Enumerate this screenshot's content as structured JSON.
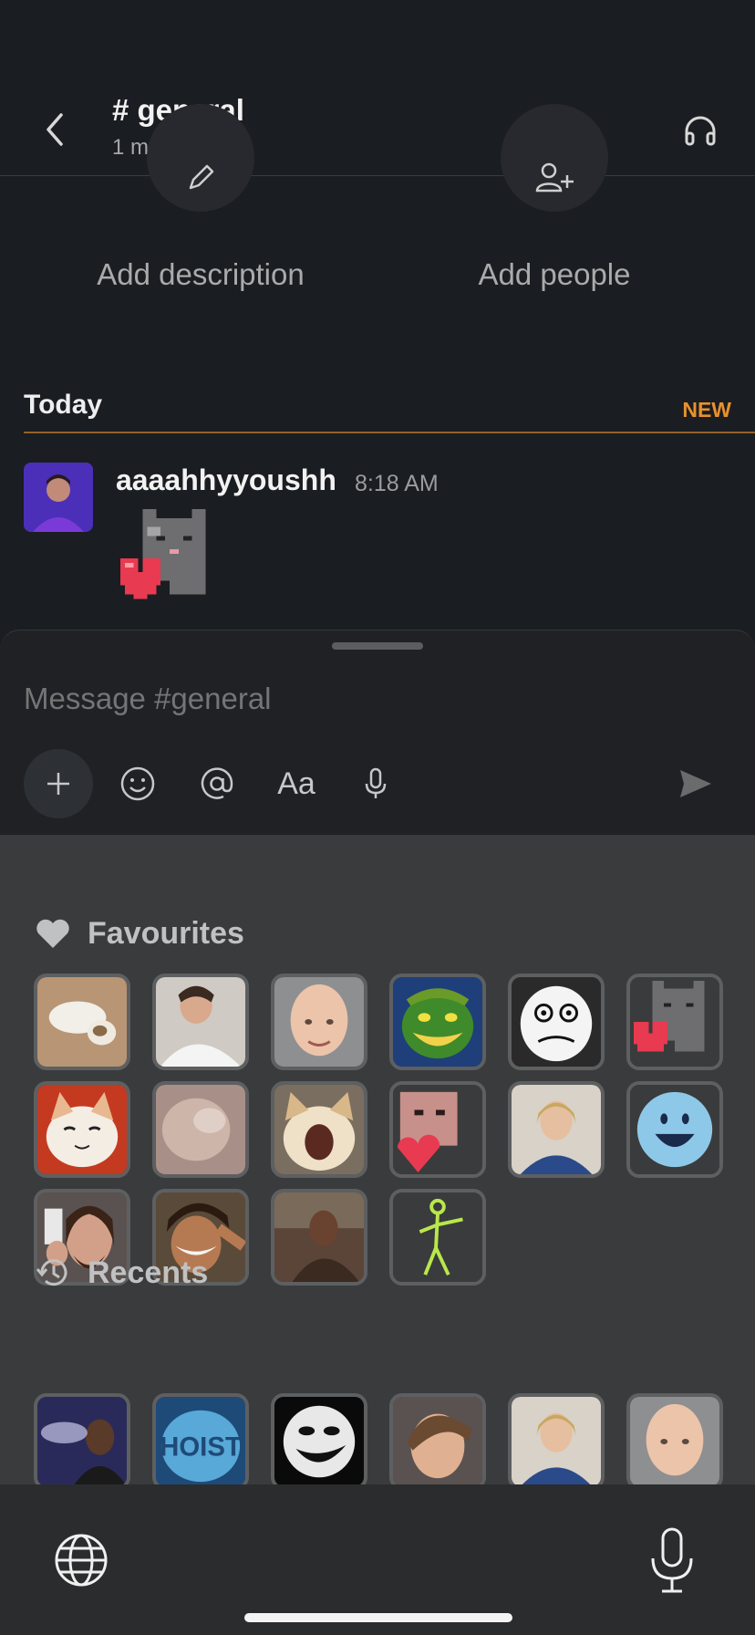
{
  "header": {
    "title": "# general",
    "subtitle": "1 member"
  },
  "intro": {
    "add_description": "Add description",
    "add_people": "Add people"
  },
  "divider": {
    "today": "Today",
    "new_badge": "NEW"
  },
  "message": {
    "user": "aaaahhyyoushh",
    "time": "8:18 AM",
    "emoji": "pixel-cat-heart"
  },
  "composer": {
    "placeholder": "Message #general",
    "format_label": "Aa"
  },
  "emoji_panel": {
    "favourites_title": "Favourites",
    "recents_title": "Recents",
    "favourites": [
      "cat-lying",
      "guy-shirt",
      "bald-guy",
      "green-goblin",
      "meme-face",
      "pixel-cat-heart",
      "cat-smile",
      "blurry-cat",
      "pop-cat",
      "guy-heart",
      "blond-guy",
      "blue-smiley",
      "guy-phone",
      "guy-salute",
      "guy-couch",
      "stick-figure"
    ],
    "recents": [
      "guy-smoke",
      "hoist-logo",
      "troll-face",
      "guy-face",
      "blond-guy",
      "bald-guy"
    ]
  },
  "colors": {
    "accent_new": "#e8912d",
    "background": "#1a1d21",
    "panel": "#3a3b3c"
  }
}
